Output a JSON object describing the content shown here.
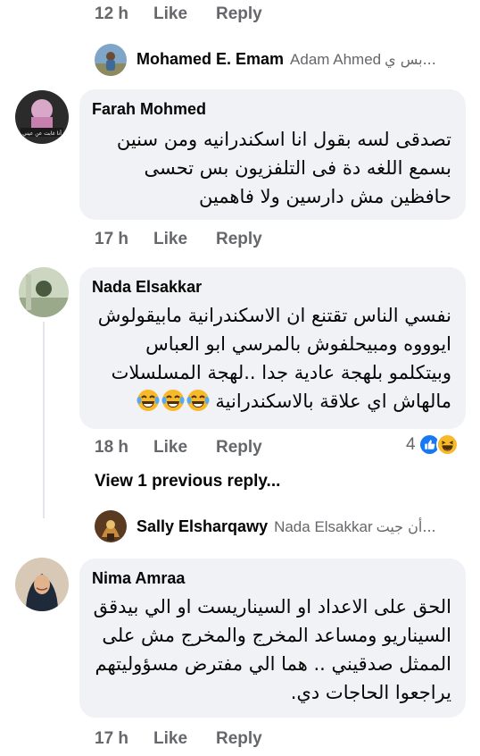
{
  "top_actions": {
    "time": "12 h",
    "like": "Like",
    "reply": "Reply"
  },
  "reply_1": {
    "name": "Mohamed E. Emam",
    "target": "Adam Ahmed",
    "snippet": "بس ي..."
  },
  "comment_1": {
    "name": "Farah Mohmed",
    "avatar_text": "أنا غابت عن عيني",
    "lines": [
      "تصدقى لسه بقول  انا اسكندرانيه  ومن سنين",
      "بسمع اللغه  دة فى التلفزيون  بس  تحسى",
      "حافظين  مش دارسين  ولا فاهمين"
    ],
    "actions": {
      "time": "17 h",
      "like": "Like",
      "reply": "Reply"
    }
  },
  "comment_2": {
    "name": "Nada Elsakkar",
    "lines": [
      "نفسي الناس تقتنع ان الاسكندرانية مابيقولوش",
      "ايوووه ومبيحلفوش بالمرسي ابو العباس",
      "وبيتكلمو بلهجة عادية جدا ..لهجة المسلسلات",
      "مالهاش اي علاقة بالاسكندرانية"
    ],
    "actions": {
      "time": "18 h",
      "like": "Like",
      "reply": "Reply"
    },
    "reaction_count": "4",
    "view_previous": "View 1 previous reply..."
  },
  "reply_2": {
    "name": "Sally Elsharqawy",
    "target": "Nada Elsakkar",
    "snippet": "أن جيت..."
  },
  "comment_3": {
    "name": "Nima Amraa",
    "lines": [
      "الحق على الاعداد او السيناريست او الي بيدقق",
      "السيناريو ومساعد المخرج والمخرج مش على",
      "الممثل صدقيني .. هما الي مفترض مسؤوليتهم",
      "يراجعوا الحاجات دي."
    ],
    "actions": {
      "time": "17 h",
      "like": "Like",
      "reply": "Reply"
    }
  },
  "colors": {
    "bubble": "#f0f2f5",
    "meta_text": "#65676b",
    "like_blue": "#1877f2",
    "haha_yellow": "#f7b928"
  },
  "icons": [
    "like-reaction-icon",
    "haha-reaction-icon",
    "laughing-tears-emoji"
  ]
}
